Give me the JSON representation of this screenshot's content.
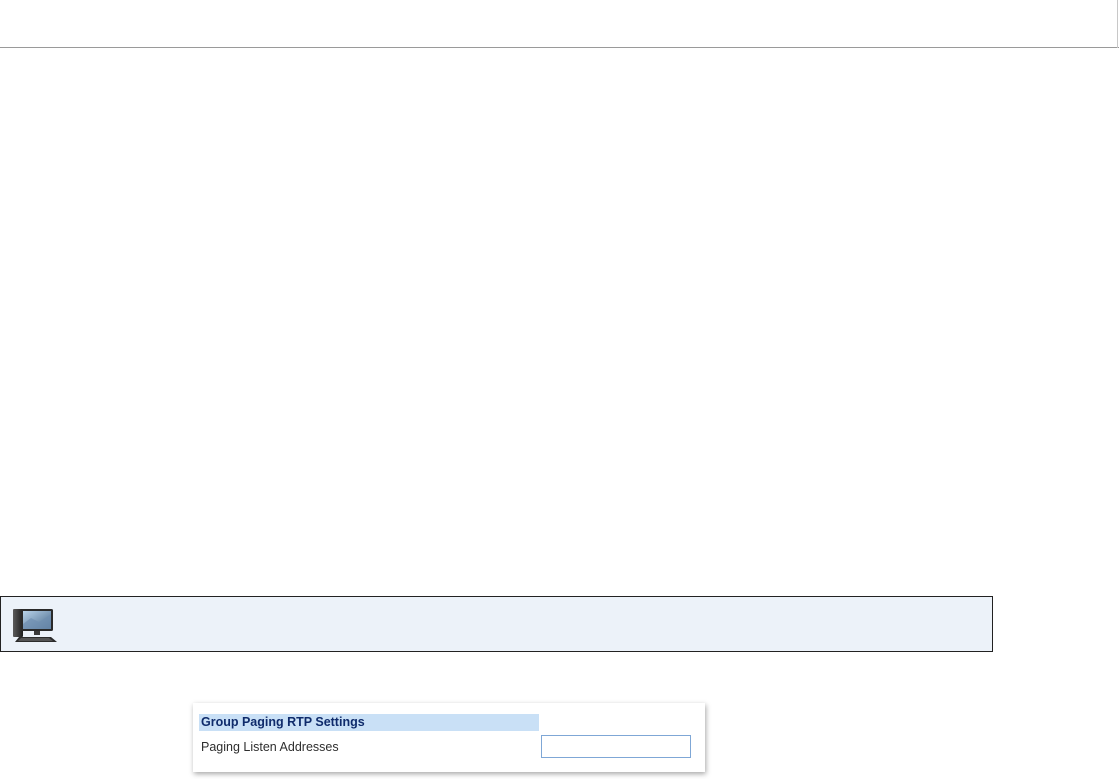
{
  "info_box": {
    "icon": "computer-icon",
    "background": "#ecf2f9"
  },
  "settings": {
    "section_title": "Group Paging RTP Settings",
    "field_label": "Paging Listen Addresses",
    "field_value": "",
    "field_placeholder": ""
  },
  "colors": {
    "header_background": "#c9e0f6",
    "header_text": "#0f2b6b",
    "input_border": "#7fa7d6"
  }
}
